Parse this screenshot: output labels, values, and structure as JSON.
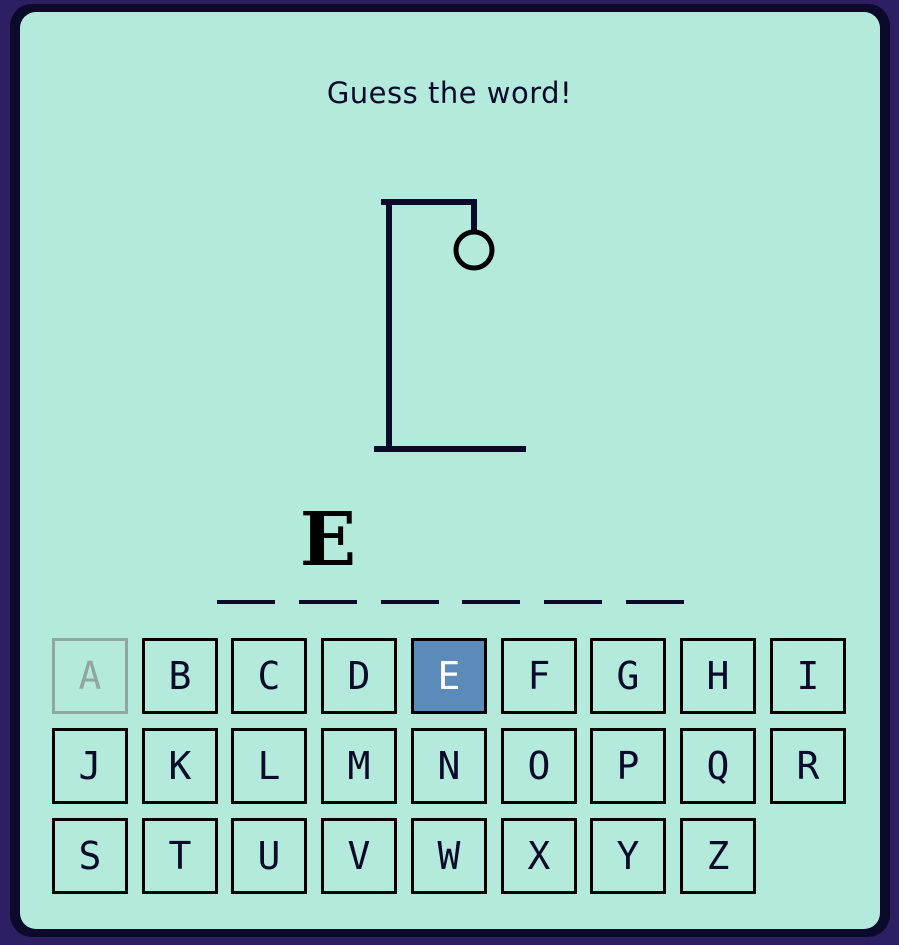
{
  "prompt": "Guess the word!",
  "word": {
    "slots": [
      "",
      "E",
      "",
      "",
      "",
      ""
    ]
  },
  "keyboard": {
    "keys": [
      {
        "letter": "A",
        "state": "used"
      },
      {
        "letter": "B",
        "state": "available"
      },
      {
        "letter": "C",
        "state": "available"
      },
      {
        "letter": "D",
        "state": "available"
      },
      {
        "letter": "E",
        "state": "correct"
      },
      {
        "letter": "F",
        "state": "available"
      },
      {
        "letter": "G",
        "state": "available"
      },
      {
        "letter": "H",
        "state": "available"
      },
      {
        "letter": "I",
        "state": "available"
      },
      {
        "letter": "J",
        "state": "available"
      },
      {
        "letter": "K",
        "state": "available"
      },
      {
        "letter": "L",
        "state": "available"
      },
      {
        "letter": "M",
        "state": "available"
      },
      {
        "letter": "N",
        "state": "available"
      },
      {
        "letter": "O",
        "state": "available"
      },
      {
        "letter": "P",
        "state": "available"
      },
      {
        "letter": "Q",
        "state": "available"
      },
      {
        "letter": "R",
        "state": "available"
      },
      {
        "letter": "S",
        "state": "available"
      },
      {
        "letter": "T",
        "state": "available"
      },
      {
        "letter": "U",
        "state": "available"
      },
      {
        "letter": "V",
        "state": "available"
      },
      {
        "letter": "W",
        "state": "available"
      },
      {
        "letter": "X",
        "state": "available"
      },
      {
        "letter": "Y",
        "state": "available"
      },
      {
        "letter": "Z",
        "state": "available"
      }
    ]
  },
  "hangman": {
    "wrong_guesses": 1,
    "parts_shown": [
      "head"
    ]
  },
  "colors": {
    "background": "#2e1f63",
    "card": "#b4eadb",
    "ink": "#0b0a2a",
    "correct_key": "#5b8bb8",
    "used_key": "#8fa6a2"
  }
}
